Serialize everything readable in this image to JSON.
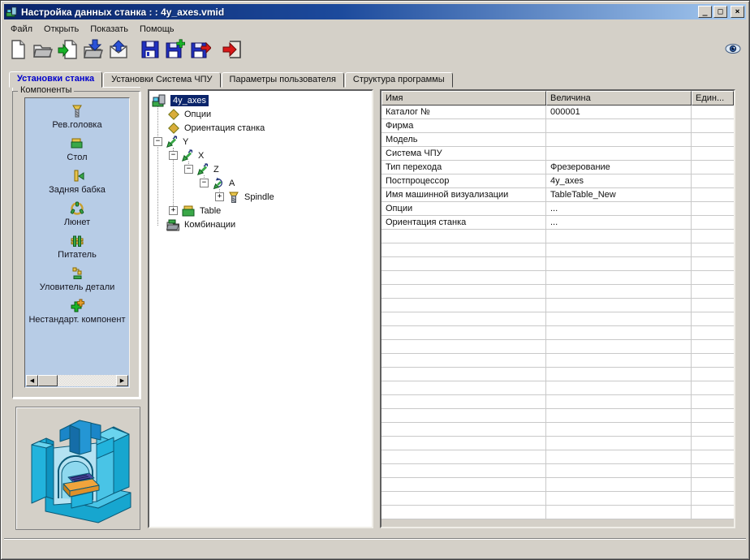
{
  "window": {
    "title": "Настройка данных станка : : 4y_axes.vmid",
    "buttons": {
      "minimize": "minimize-button",
      "maximize": "maximize-button",
      "close": "close-button"
    }
  },
  "menu": {
    "items": [
      {
        "label": "Файл"
      },
      {
        "label": "Открыть"
      },
      {
        "label": "Показать"
      },
      {
        "label": "Помощь"
      }
    ]
  },
  "toolbar": {
    "buttons": [
      {
        "icon": "new-document-icon"
      },
      {
        "icon": "open-folder-icon"
      },
      {
        "icon": "import-document-icon"
      },
      {
        "icon": "load-into-folder-icon"
      },
      {
        "icon": "send-mail-icon"
      },
      {
        "icon": "save-icon"
      },
      {
        "icon": "save-new-icon"
      },
      {
        "icon": "save-export-icon"
      },
      {
        "icon": "exit-icon"
      }
    ],
    "view_button_icon": "eye-icon"
  },
  "tabs": [
    {
      "label": "Установки станка",
      "active": true
    },
    {
      "label": "Установки Система ЧПУ",
      "active": false
    },
    {
      "label": "Параметры пользователя",
      "active": false
    },
    {
      "label": "Структура программы",
      "active": false
    }
  ],
  "components_panel": {
    "title": "Компоненты",
    "items": [
      {
        "label": "Рев.головка",
        "icon": "turret-head-icon"
      },
      {
        "label": "Стол",
        "icon": "table-icon"
      },
      {
        "label": "Задняя бабка",
        "icon": "tailstock-icon"
      },
      {
        "label": "Люнет",
        "icon": "steady-rest-icon"
      },
      {
        "label": "Питатель",
        "icon": "feeder-icon"
      },
      {
        "label": "Уловитель детали",
        "icon": "part-catcher-icon"
      },
      {
        "label": "Нестандарт. компонент",
        "icon": "custom-component-icon"
      }
    ]
  },
  "tree": {
    "items": [
      {
        "label": "4y_axes",
        "icon": "machine-icon",
        "selected": true
      },
      {
        "label": "Опции",
        "icon": "diamond-icon"
      },
      {
        "label": "Ориентация станка",
        "icon": "diamond-icon"
      },
      {
        "label": "Y",
        "icon": "linear-axis-icon",
        "expander": "minus"
      },
      {
        "label": "X",
        "icon": "linear-axis-icon",
        "expander": "minus"
      },
      {
        "label": "Z",
        "icon": "linear-axis-icon",
        "expander": "minus"
      },
      {
        "label": "A",
        "icon": "rotary-axis-icon",
        "expander": "minus"
      },
      {
        "label": "Spindle",
        "icon": "turret-head-icon",
        "expander": "plus"
      },
      {
        "label": "Table",
        "icon": "table-icon",
        "expander": "plus"
      },
      {
        "label": "Комбинации",
        "icon": "combinations-icon"
      }
    ],
    "expander_glyphs": {
      "minus": "−",
      "plus": "+"
    }
  },
  "properties_table": {
    "columns": [
      "Имя",
      "Величина",
      "Един..."
    ],
    "rows": [
      {
        "name": "Каталог №",
        "value": "000001",
        "unit": ""
      },
      {
        "name": "Фирма",
        "value": "",
        "unit": ""
      },
      {
        "name": "Модель",
        "value": "",
        "unit": ""
      },
      {
        "name": "Система ЧПУ",
        "value": "",
        "unit": ""
      },
      {
        "name": "Тип перехода",
        "value": "Фрезерование",
        "unit": ""
      },
      {
        "name": "Постпроцессор",
        "value": "4y_axes",
        "unit": ""
      },
      {
        "name": "Имя машинной визуализации",
        "value": "TableTable_New",
        "unit": ""
      },
      {
        "name": "Опции",
        "value": "...",
        "unit": ""
      },
      {
        "name": "Ориентация станка",
        "value": "...",
        "unit": ""
      }
    ],
    "empty_row_count": 21
  },
  "preview": {
    "icon": "machine-preview-image"
  },
  "colors": {
    "titlebar_left": "#0a246a",
    "titlebar_right": "#a6caf0",
    "window_bg": "#d4d0c8",
    "list_bg": "#b7cce6",
    "selection": "#0a246a",
    "active_tab_text": "#0000cc",
    "machine_cyan": "#22b3dc"
  }
}
